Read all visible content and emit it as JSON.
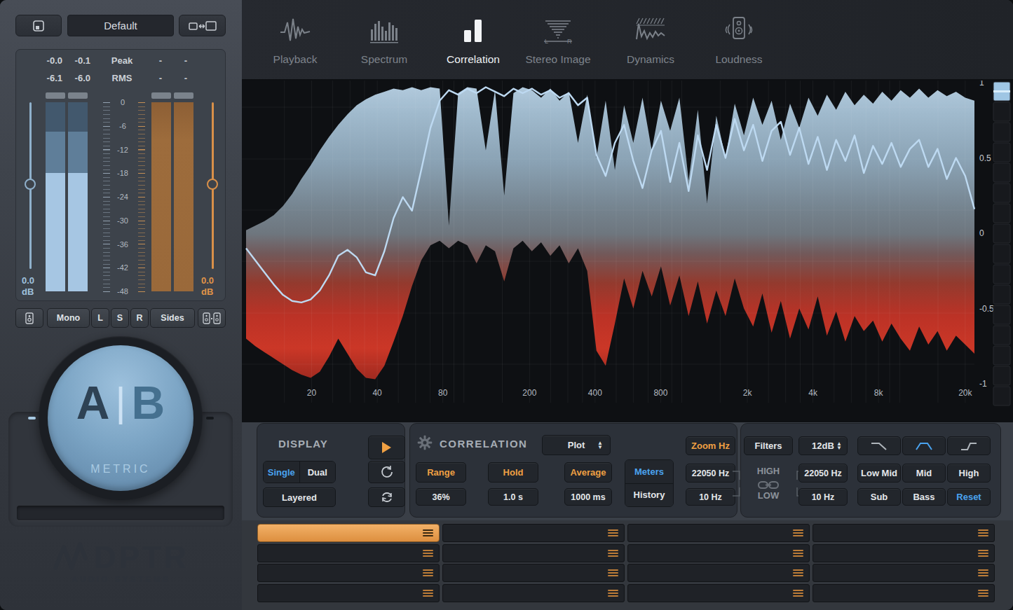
{
  "left_panel": {
    "preset": "Default",
    "meter": {
      "peak_label": "Peak",
      "rms_label": "RMS",
      "peak_values": [
        "-0.0",
        "-0.1"
      ],
      "rms_values": [
        "-6.1",
        "-6.0"
      ],
      "right_peak_values": [
        "-",
        "-"
      ],
      "right_rms_values": [
        "-",
        "-"
      ],
      "scale": [
        "0",
        "-6",
        "-12",
        "-18",
        "-24",
        "-30",
        "-36",
        "-42",
        "-48"
      ],
      "left_fader_value": "0.0",
      "right_fader_value": "0.0",
      "db_unit": "dB"
    },
    "channel_buttons": [
      "Mono",
      "L",
      "S",
      "R",
      "Sides"
    ],
    "knob": {
      "label_a": "A",
      "divider": "|",
      "label_b": "B",
      "caption": "METRIC"
    },
    "brand": {
      "name": "DPTR",
      "subtitle": "AUDIO SYSTEMS"
    }
  },
  "nav": {
    "items": [
      {
        "label": "Playback",
        "active": false
      },
      {
        "label": "Spectrum",
        "active": false
      },
      {
        "label": "Correlation",
        "active": true
      },
      {
        "label": "Stereo Image",
        "active": false
      },
      {
        "label": "Dynamics",
        "active": false
      },
      {
        "label": "Loudness",
        "active": false
      }
    ]
  },
  "plot": {
    "type": "area",
    "x_ticks": [
      {
        "f": 20,
        "label": "20"
      },
      {
        "f": 40,
        "label": "40"
      },
      {
        "f": 80,
        "label": "80"
      },
      {
        "f": 200,
        "label": "200"
      },
      {
        "f": 400,
        "label": "400"
      },
      {
        "f": 800,
        "label": "800"
      },
      {
        "f": 2000,
        "label": "2k"
      },
      {
        "f": 4000,
        "label": "4k"
      },
      {
        "f": 8000,
        "label": "8k"
      },
      {
        "f": 20000,
        "label": "20k"
      }
    ],
    "y_ticks": [
      {
        "v": 1,
        "label": "1"
      },
      {
        "v": 0.5,
        "label": "0.5"
      },
      {
        "v": 0,
        "label": "0"
      },
      {
        "v": -0.5,
        "label": "-0.5"
      },
      {
        "v": -1,
        "label": "-1"
      }
    ],
    "freq_min": 10,
    "freq_max": 22050,
    "grid_freqs": [
      15,
      20,
      25,
      30,
      35,
      40,
      50,
      60,
      70,
      80,
      90,
      100,
      150,
      200,
      250,
      300,
      350,
      400,
      500,
      600,
      700,
      800,
      900,
      1000,
      1500,
      2000,
      2500,
      3000,
      3500,
      4000,
      5000,
      6000,
      7000,
      8000,
      9000,
      10000,
      15000,
      20000
    ],
    "envelope_top": [
      0.02,
      0.05,
      0.08,
      0.12,
      0.18,
      0.26,
      0.36,
      0.45,
      0.55,
      0.64,
      0.72,
      0.79,
      0.85,
      0.89,
      0.92,
      0.94,
      0.96,
      0.95,
      0.97,
      0.95,
      0.97,
      0.96,
      0.05,
      0.93,
      0.97,
      0.96,
      0.55,
      0.95,
      0.25,
      0.93,
      0.97,
      0.95,
      0.9,
      0.96,
      0.88,
      0.94,
      0.6,
      0.92,
      0.5,
      0.88,
      0.42,
      0.85,
      0.6,
      0.9,
      0.55,
      0.88,
      0.68,
      0.9,
      0.35,
      0.82,
      0.2,
      0.78,
      0.5,
      0.86,
      0.65,
      0.9,
      0.72,
      0.88,
      0.62,
      0.86,
      0.7,
      0.9,
      0.78,
      0.92,
      0.82,
      0.94,
      0.85,
      0.92,
      0.86,
      0.94,
      0.88,
      0.95,
      0.9,
      0.96,
      0.9,
      0.95,
      0.91,
      0.94,
      0.9,
      0.88
    ],
    "envelope_bottom": [
      -0.7,
      -0.75,
      -0.79,
      -0.83,
      -0.87,
      -0.91,
      -0.94,
      -0.96,
      -0.92,
      -0.82,
      -0.7,
      -0.8,
      -0.9,
      -0.96,
      -0.97,
      -0.88,
      -0.72,
      -0.55,
      -0.35,
      -0.18,
      -0.08,
      -0.05,
      -0.1,
      -0.05,
      -0.08,
      -0.2,
      -0.08,
      -0.12,
      -0.32,
      -0.1,
      -0.05,
      -0.12,
      -0.06,
      -0.15,
      -0.08,
      -0.2,
      -0.1,
      -0.25,
      -0.78,
      -0.88,
      -0.6,
      -0.3,
      -0.5,
      -0.25,
      -0.42,
      -0.22,
      -0.48,
      -0.28,
      -0.55,
      -0.32,
      -0.6,
      -0.38,
      -0.55,
      -0.3,
      -0.5,
      -0.62,
      -0.4,
      -0.66,
      -0.45,
      -0.7,
      -0.5,
      -0.64,
      -0.42,
      -0.68,
      -0.52,
      -0.72,
      -0.55,
      -0.65,
      -0.58,
      -0.72,
      -0.6,
      -0.7,
      -0.78,
      -0.62,
      -0.74,
      -0.65,
      -0.78,
      -0.68,
      -0.74,
      -0.8
    ],
    "line": [
      -0.1,
      -0.18,
      -0.26,
      -0.34,
      -0.41,
      -0.45,
      -0.46,
      -0.44,
      -0.38,
      -0.28,
      -0.15,
      -0.11,
      -0.16,
      -0.26,
      -0.28,
      -0.12,
      0.1,
      0.24,
      0.15,
      0.42,
      0.7,
      0.88,
      0.95,
      0.92,
      0.96,
      0.93,
      0.97,
      0.94,
      0.91,
      0.96,
      0.93,
      0.96,
      0.92,
      0.95,
      0.9,
      0.93,
      0.85,
      0.9,
      0.52,
      0.38,
      0.6,
      0.72,
      0.48,
      0.3,
      0.55,
      0.68,
      0.34,
      0.6,
      0.28,
      0.65,
      0.42,
      0.72,
      0.5,
      0.76,
      0.55,
      0.72,
      0.48,
      0.68,
      0.74,
      0.52,
      0.7,
      0.46,
      0.64,
      0.42,
      0.62,
      0.48,
      0.65,
      0.4,
      0.58,
      0.46,
      0.6,
      0.44,
      0.56,
      0.62,
      0.44,
      0.56,
      0.36,
      0.5,
      0.38,
      0.16
    ]
  },
  "controls": {
    "display": {
      "title": "DISPLAY",
      "single": "Single",
      "dual": "Dual",
      "layered": "Layered"
    },
    "correlation": {
      "title": "CORRELATION",
      "mode": "Plot",
      "range_label": "Range",
      "range_value": "36%",
      "hold_label": "Hold",
      "hold_value": "1.0 s",
      "average_label": "Average",
      "average_value": "1000 ms",
      "meters_label": "Meters",
      "history_label": "History",
      "zoom_label": "Zoom Hz",
      "zoom_high": "22050 Hz",
      "zoom_low": "10 Hz"
    },
    "filters": {
      "title": "Filters",
      "slope": "12dB",
      "high_label": "HIGH",
      "low_label": "LOW",
      "high_value": "22050 Hz",
      "low_value": "10 Hz",
      "band_row1": [
        "Low Mid",
        "Mid",
        "High"
      ],
      "band_row2": [
        "Sub",
        "Bass",
        "Reset"
      ]
    }
  },
  "snapshots": {
    "rows": 4,
    "cols": 4,
    "active_row": 0,
    "active_col": 0
  },
  "colors": {
    "accent_orange": "#f0a043",
    "accent_blue": "#4aa3f0",
    "meter_blue": "#a6c6e3",
    "meter_orange": "#9a693a",
    "plot_line": "#bdd9f1"
  }
}
